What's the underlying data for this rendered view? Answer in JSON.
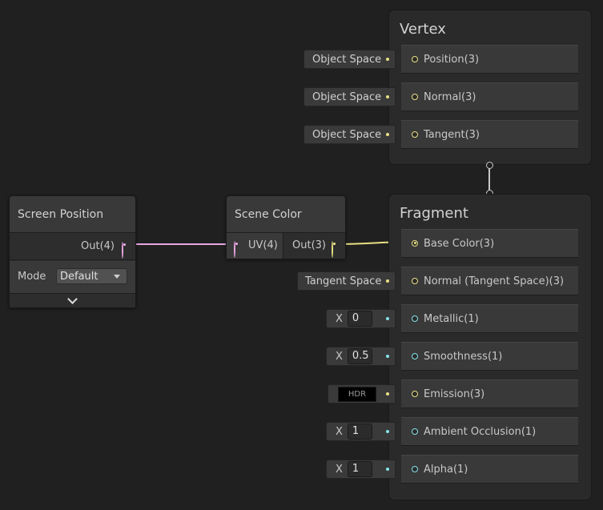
{
  "vertex": {
    "title": "Vertex",
    "blocks": [
      {
        "label": "Position(3)",
        "input": "Object Space"
      },
      {
        "label": "Normal(3)",
        "input": "Object Space"
      },
      {
        "label": "Tangent(3)",
        "input": "Object Space"
      }
    ]
  },
  "fragment": {
    "title": "Fragment",
    "base_color": "Base Color(3)",
    "normal": {
      "label": "Normal (Tangent Space)(3)",
      "input": "Tangent Space"
    },
    "metallic": {
      "label": "Metallic(1)",
      "axis": "X",
      "value": "0"
    },
    "smoothness": {
      "label": "Smoothness(1)",
      "axis": "X",
      "value": "0.5"
    },
    "emission": {
      "label": "Emission(3)",
      "swatch": "HDR"
    },
    "ambient_occlusion": {
      "label": "Ambient Occlusion(1)",
      "axis": "X",
      "value": "1"
    },
    "alpha": {
      "label": "Alpha(1)",
      "axis": "X",
      "value": "1"
    }
  },
  "screen_position": {
    "title": "Screen Position",
    "out": "Out(4)",
    "mode_label": "Mode",
    "mode_value": "Default"
  },
  "scene_color": {
    "title": "Scene Color",
    "in": "UV(4)",
    "out": "Out(3)"
  },
  "colors": {
    "background": "#202020",
    "vector3": "#e8e083",
    "vector1": "#84e4e7",
    "vector4": "#e8a6e2"
  },
  "icons": [
    "chevron-down-icon",
    "dropdown-caret-icon"
  ]
}
